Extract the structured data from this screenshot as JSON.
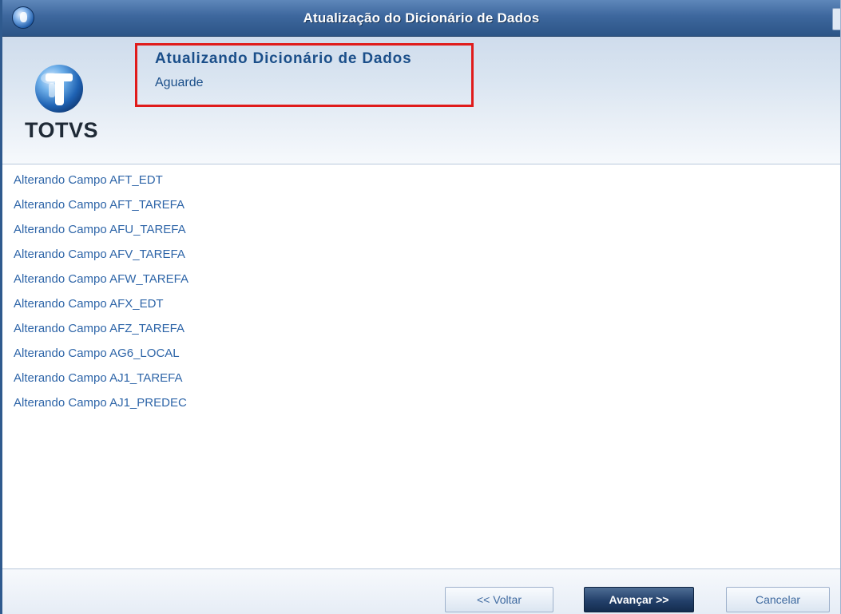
{
  "window": {
    "title": "Atualização do Dicionário de Dados"
  },
  "header": {
    "logo_text": "TOTVS",
    "title": "Atualizando Dicionário de Dados",
    "subtitle": "Aguarde"
  },
  "log": {
    "items": [
      "Alterando Campo AFT_EDT",
      "Alterando Campo AFT_TAREFA",
      "Alterando Campo AFU_TAREFA",
      "Alterando Campo AFV_TAREFA",
      "Alterando Campo AFW_TAREFA",
      "Alterando Campo AFX_EDT",
      "Alterando Campo AFZ_TAREFA",
      "Alterando Campo AG6_LOCAL",
      "Alterando Campo AJ1_TAREFA",
      "Alterando Campo AJ1_PREDEC"
    ]
  },
  "footer": {
    "back_label": "<< Voltar",
    "next_label": "Avançar >>",
    "cancel_label": "Cancelar"
  },
  "colors": {
    "highlight_border": "#e01b1b",
    "log_text": "#2e65a8",
    "header_text": "#1b4f8a",
    "titlebar": "#3d679d"
  },
  "icons": {
    "title": "totvs-globe-icon",
    "logo": "totvs-logo-icon"
  }
}
